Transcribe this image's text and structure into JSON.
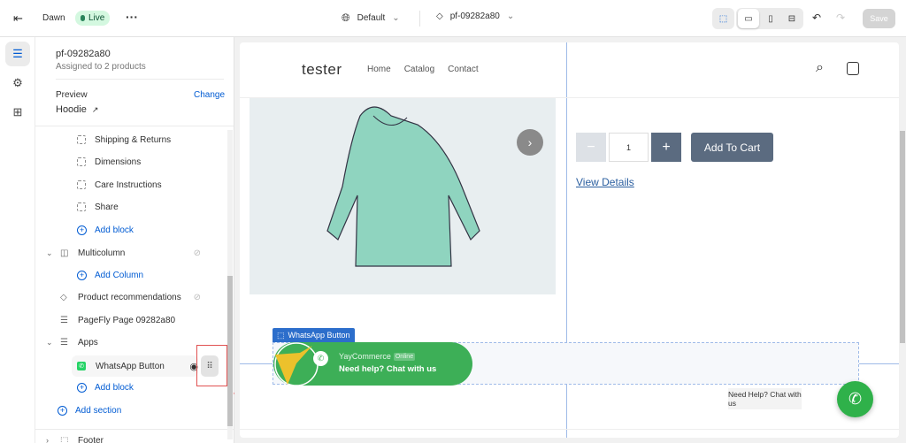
{
  "topbar": {
    "theme": "Dawn",
    "status": "Live",
    "template": "Default",
    "page": "pf-09282a80",
    "save": "Save"
  },
  "sidebar": {
    "page_name": "pf-09282a80",
    "assigned": "Assigned to 2 products",
    "preview_label": "Preview",
    "change": "Change",
    "preview_product": "Hoodie",
    "blocks": [
      "Shipping & Returns",
      "Dimensions",
      "Care Instructions",
      "Share"
    ],
    "add_block": "Add block",
    "multicolumn": "Multicolumn",
    "add_column": "Add Column",
    "product_recs": "Product recommendations",
    "pagefly": "PageFly Page 09282a80",
    "apps": "Apps",
    "whatsapp": "WhatsApp Button",
    "add_block2": "Add block",
    "add_section": "Add section",
    "footer": "Footer"
  },
  "store": {
    "logo": "tester",
    "nav": [
      "Home",
      "Catalog",
      "Contact"
    ],
    "qty": "1",
    "add_to_cart": "Add To Cart",
    "view_details": "View Details"
  },
  "widget": {
    "tag": "WhatsApp Button",
    "brand": "YayCommerce",
    "online": "Online",
    "cta": "Need help? Chat with us",
    "float_label": "Need Help? Chat with us"
  },
  "colors": {
    "accent": "#005bd3",
    "whatsapp": "#3daf57",
    "cart": "#5b6b80"
  }
}
